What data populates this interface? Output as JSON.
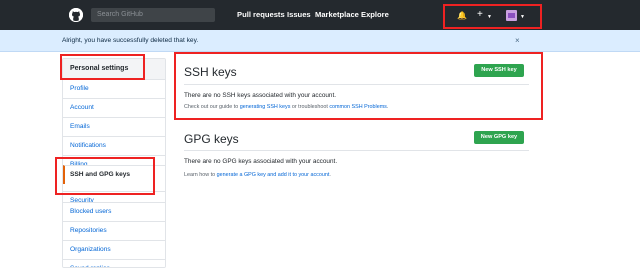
{
  "header": {
    "search_placeholder": "Search GitHub",
    "nav": [
      "Pull requests",
      "Issues",
      "Marketplace",
      "Explore"
    ],
    "icons": [
      "bell-icon",
      "plus-icon",
      "avatar"
    ]
  },
  "flash": {
    "message": "Alright, you have successfully deleted that key.",
    "close": "×"
  },
  "sidebar": {
    "heading": "Personal settings",
    "items": [
      {
        "label": "Profile"
      },
      {
        "label": "Account"
      },
      {
        "label": "Emails"
      },
      {
        "label": "Notifications"
      },
      {
        "label": "Billing"
      },
      {
        "label": "SSH and GPG keys"
      },
      {
        "label": "Security"
      },
      {
        "label": "Blocked users"
      },
      {
        "label": "Repositories"
      },
      {
        "label": "Organizations"
      },
      {
        "label": "Saved replies"
      }
    ]
  },
  "ssh": {
    "title": "SSH keys",
    "button": "New SSH key",
    "empty": "There are no SSH keys associated with your account.",
    "help_prefix": "Check out our guide to ",
    "help_link1": "generating SSH keys",
    "help_middle": " or troubleshoot ",
    "help_link2": "common SSH Problems",
    "help_suffix": "."
  },
  "gpg": {
    "title": "GPG keys",
    "button": "New GPG key",
    "empty": "There are no GPG keys associated with your account.",
    "help_prefix": "Learn how to ",
    "help_link": "generate a GPG key and add it to your account",
    "help_suffix": "."
  },
  "colors": {
    "header_bg": "#24292e",
    "flash_bg": "#dbedff",
    "link": "#0366d6",
    "button_green": "#2ea44f",
    "highlight_red": "#e22222"
  }
}
